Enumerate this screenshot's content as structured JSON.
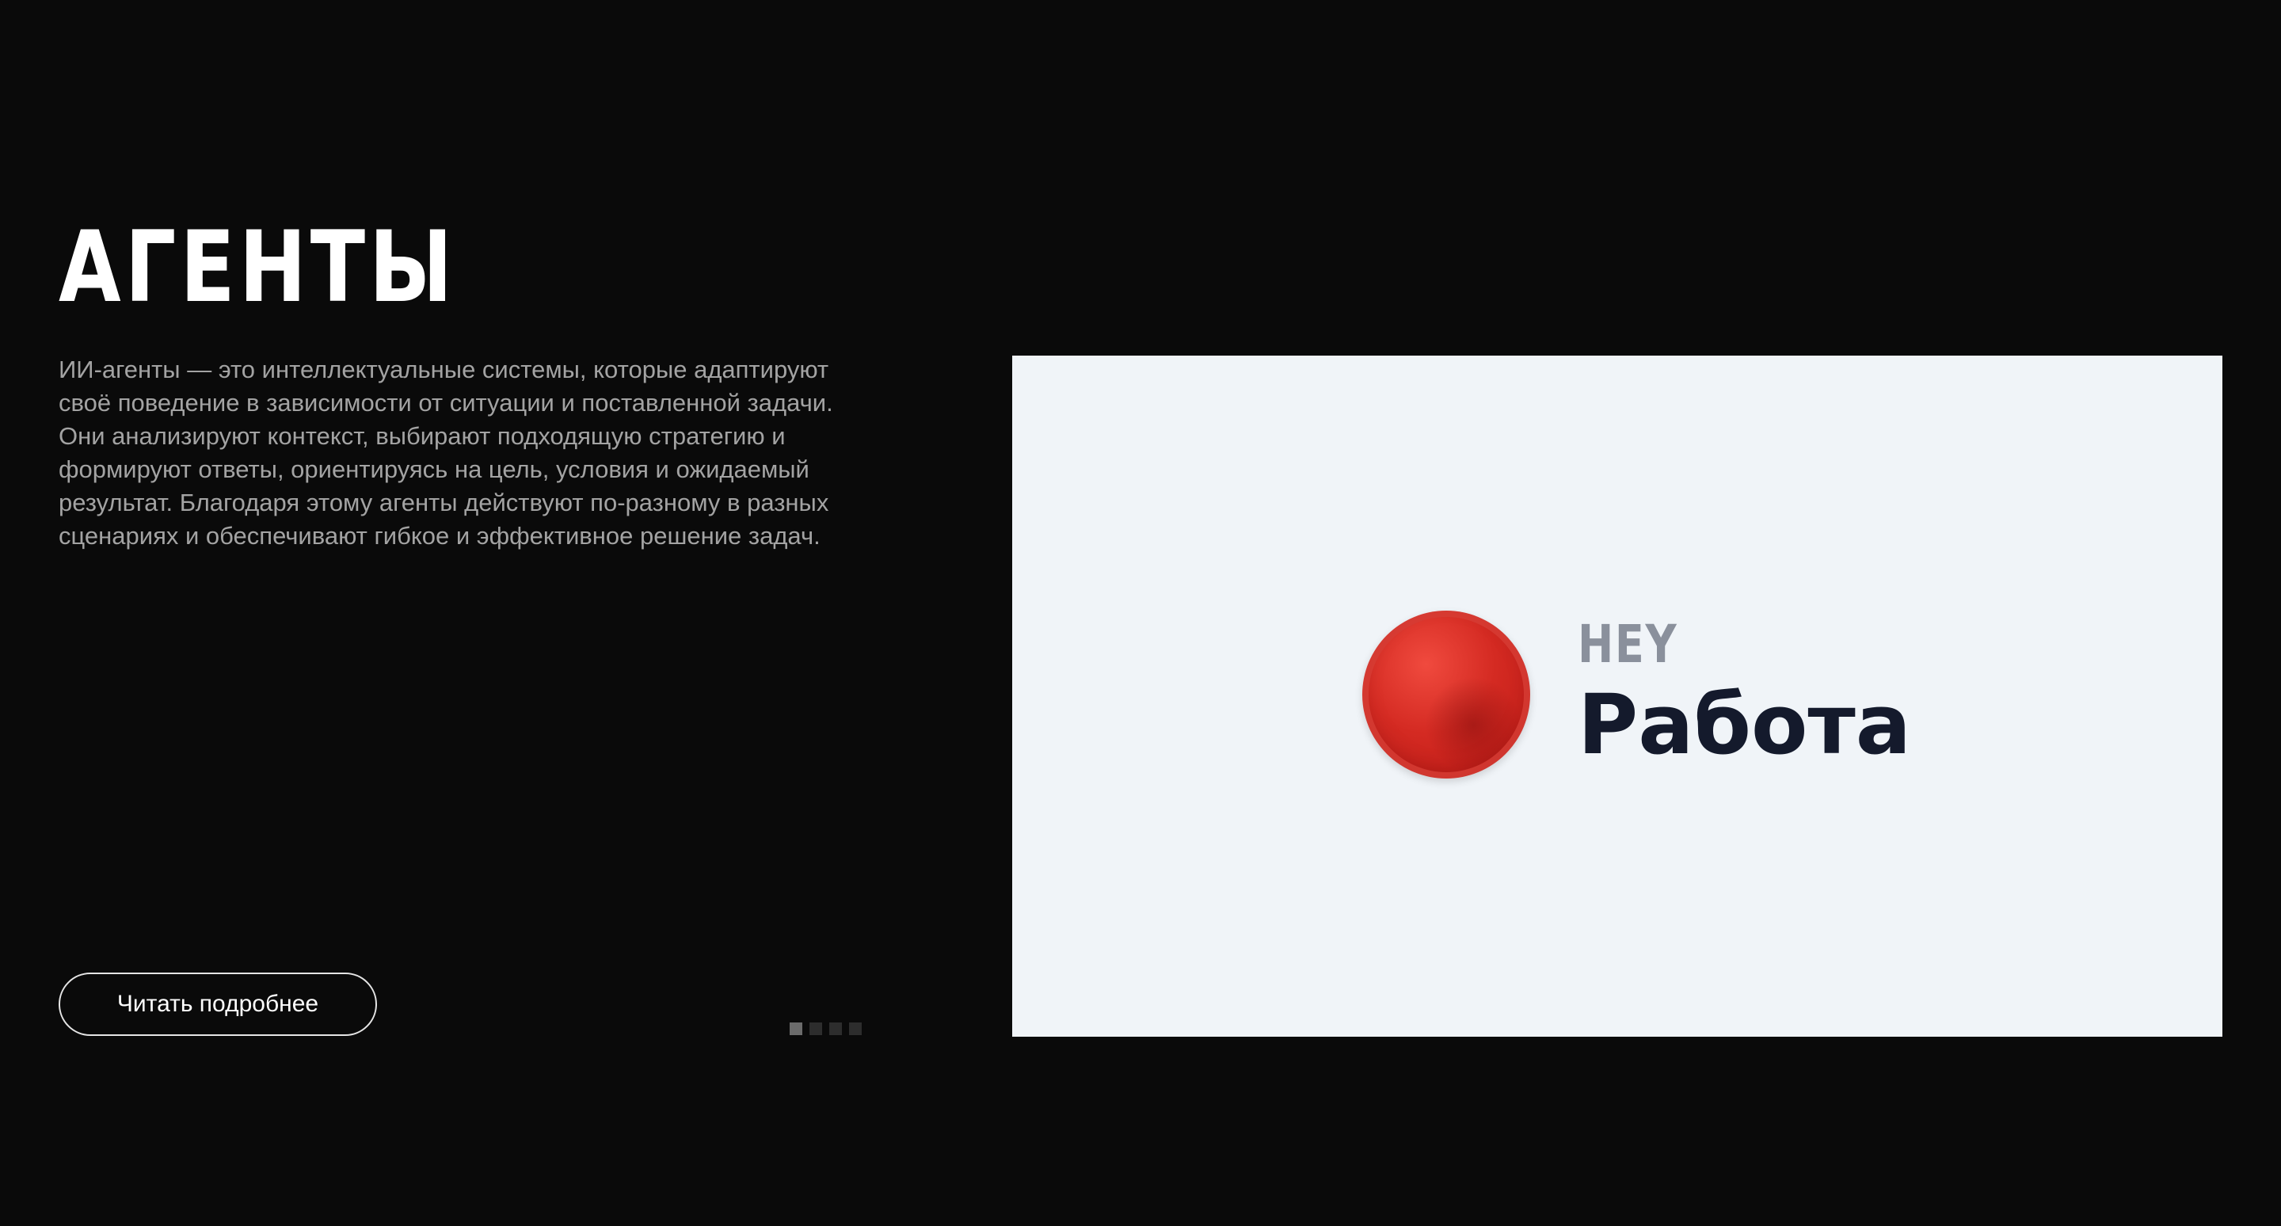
{
  "section": {
    "title": "АГЕНТЫ",
    "description": "ИИ-агенты — это интеллектуальные системы, которые адаптируют своё поведение в зависимости от ситуации и поставленной задачи. Они анализируют контекст, выбирают подходящую стратегию и формируют ответы, ориентируясь на цель, условия и ожидаемый результат. Благодаря этому агенты действуют по-разному в разных сценариях и обеспечивают гибкое и эффективное решение задач.",
    "read_more_label": "Читать подробнее"
  },
  "pagination": {
    "total": 4,
    "active_index": 0
  },
  "preview": {
    "logo_small": "HEY",
    "logo_large": "Работа",
    "orb_icon": "red-orb-icon"
  },
  "colors": {
    "background": "#0a0a0a",
    "title": "#ffffff",
    "description": "#a3a3a3",
    "preview_background": "#f0f4f8",
    "logo_small": "#8a909c",
    "logo_large": "#141a2c",
    "orb": "#d42a22"
  }
}
